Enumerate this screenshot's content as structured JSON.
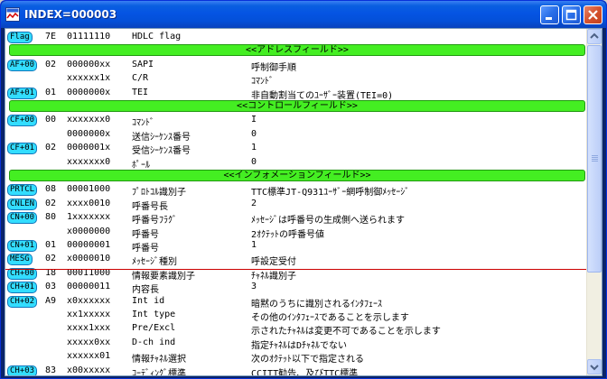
{
  "window": {
    "title": "INDEX=000003"
  },
  "colors": {
    "tag": "#33ddff",
    "band": "#44ee22",
    "separator": "#cc0000",
    "title_bar": "#0554e3"
  },
  "rows": [
    {
      "kind": "field",
      "tag": "Flag",
      "hex": "7E",
      "bits": "01111110",
      "name": "HDLC flag",
      "value": ""
    },
    {
      "kind": "band",
      "text": "<<アドレスフィールド>>"
    },
    {
      "kind": "field",
      "tag": "AF+00",
      "hex": "02",
      "bits": "000000xx",
      "name": "SAPI",
      "value": "呼制御手順"
    },
    {
      "kind": "field",
      "tag": "",
      "hex": "",
      "bits": "xxxxxx1x",
      "name": "C/R",
      "value": "ｺﾏﾝﾄﾞ"
    },
    {
      "kind": "field",
      "tag": "AF+01",
      "hex": "01",
      "bits": "0000000x",
      "name": "TEI",
      "value": "非自動割当てのﾕｰｻﾞｰ装置(TEI=0)"
    },
    {
      "kind": "band",
      "text": "<<コントロールフィールド>>"
    },
    {
      "kind": "field",
      "tag": "CF+00",
      "hex": "00",
      "bits": "xxxxxxx0",
      "name": "ｺﾏﾝﾄﾞ",
      "value": "I"
    },
    {
      "kind": "field",
      "tag": "",
      "hex": "",
      "bits": "0000000x",
      "name": "送信ｼｰｹﾝｽ番号",
      "value": "0"
    },
    {
      "kind": "field",
      "tag": "CF+01",
      "hex": "02",
      "bits": "0000001x",
      "name": "受信ｼｰｹﾝｽ番号",
      "value": "1"
    },
    {
      "kind": "field",
      "tag": "",
      "hex": "",
      "bits": "xxxxxxx0",
      "name": "ﾎﾟｰﾙ",
      "value": "0"
    },
    {
      "kind": "band",
      "text": "<<インフォメーションフィールド>>"
    },
    {
      "kind": "field",
      "tag": "PRTCL",
      "hex": "08",
      "bits": "00001000",
      "name": "ﾌﾟﾛﾄｺﾙ識別子",
      "value": "TTC標準JT-Q931ﾕｰｻﾞｰ網呼制御ﾒｯｾｰｼﾞ"
    },
    {
      "kind": "field",
      "tag": "CNLEN",
      "hex": "02",
      "bits": "xxxx0010",
      "name": "呼番号長",
      "value": "2"
    },
    {
      "kind": "field",
      "tag": "CN+00",
      "hex": "80",
      "bits": "1xxxxxxx",
      "name": "呼番号ﾌﾗｸﾞ",
      "value": "ﾒｯｾｰｼﾞは呼番号の生成側へ送られます"
    },
    {
      "kind": "field",
      "tag": "",
      "hex": "",
      "bits": "x0000000",
      "name": "呼番号",
      "value": "2ｵｸﾃｯﾄの呼番号値"
    },
    {
      "kind": "field",
      "tag": "CN+01",
      "hex": "01",
      "bits": "00000001",
      "name": "呼番号",
      "value": "1"
    },
    {
      "kind": "field",
      "tag": "MESG",
      "hex": "02",
      "bits": "x0000010",
      "name": "ﾒｯｾｰｼﾞ種別",
      "value": "呼設定受付"
    },
    {
      "kind": "field",
      "tag": "CH+00",
      "hex": "18",
      "bits": "00011000",
      "name": "情報要素識別子",
      "value": "ﾁｬﾈﾙ識別子"
    },
    {
      "kind": "field",
      "tag": "CH+01",
      "hex": "03",
      "bits": "00000011",
      "name": "内容長",
      "value": "3"
    },
    {
      "kind": "field",
      "tag": "CH+02",
      "hex": "A9",
      "bits": "x0xxxxxx",
      "name": "Int id",
      "value": "暗黙のうちに識別されるｲﾝﾀﾌｪｰｽ"
    },
    {
      "kind": "field",
      "tag": "",
      "hex": "",
      "bits": "xx1xxxxx",
      "name": "Int type",
      "value": "その他のｲﾝﾀﾌｪｰｽであることを示します"
    },
    {
      "kind": "field",
      "tag": "",
      "hex": "",
      "bits": "xxxx1xxx",
      "name": "Pre/Excl",
      "value": "示されたﾁｬﾈﾙは変更不可であることを示します"
    },
    {
      "kind": "field",
      "tag": "",
      "hex": "",
      "bits": "xxxxx0xx",
      "name": "D-ch ind",
      "value": "指定ﾁｬﾈﾙはDﾁｬﾈﾙでない"
    },
    {
      "kind": "field",
      "tag": "",
      "hex": "",
      "bits": "xxxxxx01",
      "name": "情報ﾁｬﾈﾙ選択",
      "value": "次のｵｸﾃｯﾄ以下で指定される"
    },
    {
      "kind": "field",
      "tag": "CH+03",
      "hex": "83",
      "bits": "x00xxxxx",
      "name": "ｺｰﾃﾞｨﾝｸﾞ標準",
      "value": "CCITT勧告、及びTTC標準"
    }
  ]
}
